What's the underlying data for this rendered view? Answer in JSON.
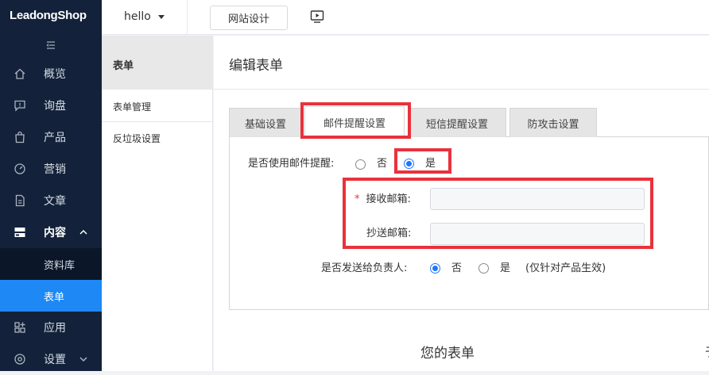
{
  "nav": {
    "logo": "LeadongShop",
    "items": [
      {
        "label": "概览",
        "icon": "home-icon"
      },
      {
        "label": "询盘",
        "icon": "message-icon"
      },
      {
        "label": "产品",
        "icon": "bag-icon"
      },
      {
        "label": "营销",
        "icon": "gauge-icon"
      },
      {
        "label": "文章",
        "icon": "document-icon"
      },
      {
        "label": "内容",
        "icon": "storage-icon"
      },
      {
        "label": "资料库"
      },
      {
        "label": "表单"
      },
      {
        "label": "应用",
        "icon": "apps-icon"
      },
      {
        "label": "设置",
        "icon": "settings-icon"
      }
    ]
  },
  "topbar": {
    "site": "hello",
    "design_button": "网站设计"
  },
  "side2": {
    "title": "表单",
    "items": [
      "表单管理",
      "反垃圾设置"
    ]
  },
  "page": {
    "title": "编辑表单",
    "tabs": [
      "基础设置",
      "邮件提醒设置",
      "短信提醒设置",
      "防攻击设置"
    ],
    "use_email_label": "是否使用邮件提醒:",
    "option_no": "否",
    "option_yes": "是",
    "receive_label": "接收邮箱:",
    "receive_required": "*",
    "cc_label": "抄送邮箱:",
    "send_owner_label": "是否发送给负责人:",
    "owner_note": "(仅针对产品生效)",
    "your_form": "您的表单",
    "edge_char": "于"
  },
  "colors": {
    "nav_bg": "#13223a",
    "nav_active": "#1e88f5",
    "radio_accent": "#1e78ff",
    "highlight_red": "#e8323c"
  }
}
